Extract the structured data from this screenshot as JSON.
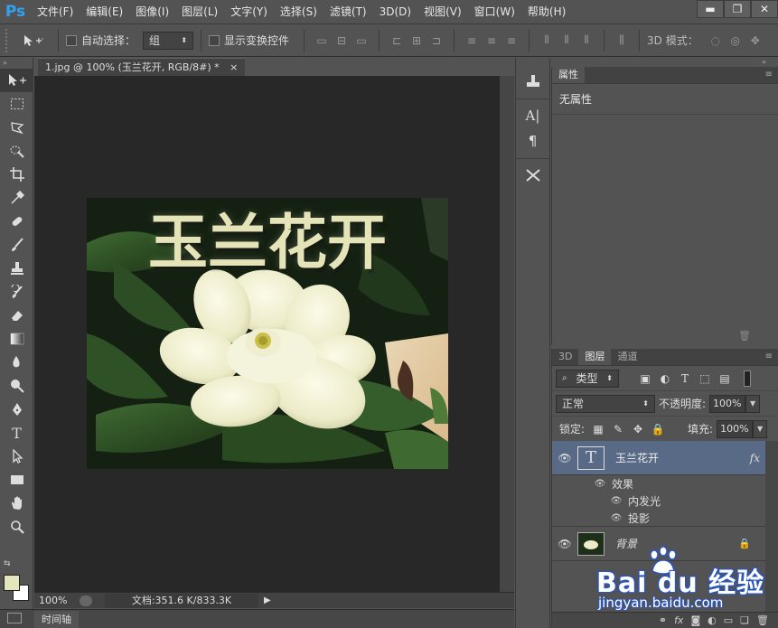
{
  "app": {
    "logo": "Ps"
  },
  "menu": [
    "文件(F)",
    "编辑(E)",
    "图像(I)",
    "图层(L)",
    "文字(Y)",
    "选择(S)",
    "滤镜(T)",
    "3D(D)",
    "视图(V)",
    "窗口(W)",
    "帮助(H)"
  ],
  "window_controls": {
    "minimize": "▬",
    "maximize": "❐",
    "close": "✕"
  },
  "options_bar": {
    "auto_select_label": "自动选择：",
    "auto_select_value": "组",
    "show_transform_label": "显示变换控件",
    "mode_3d_label": "3D 模式："
  },
  "document": {
    "tab_title": "1.jpg @ 100% (玉兰花开, RGB/8#) *",
    "tab_close": "×",
    "image_text": "玉兰花开",
    "zoom": "100%",
    "doc_size": "文档:351.6 K/833.3K"
  },
  "timeline_tab": "时间轴",
  "properties_panel": {
    "tab": "属性",
    "title": "无属性"
  },
  "layers_panel": {
    "tabs": [
      "3D",
      "图层",
      "通道"
    ],
    "filter_label": "类型",
    "blend_mode": "正常",
    "opacity_label": "不透明度:",
    "opacity_value": "100%",
    "lock_label": "锁定:",
    "fill_label": "填充:",
    "fill_value": "100%",
    "layers": [
      {
        "name": "玉兰花开",
        "thumb": "T",
        "fx": "fx",
        "effects_label": "效果",
        "effects": [
          "内发光",
          "投影"
        ]
      },
      {
        "name": "背景"
      }
    ]
  },
  "watermark": {
    "brand": "Bai du 经验",
    "url": "jingyan.baidu.com"
  },
  "colors": {
    "foreground": "#e5e6bb",
    "background": "#ffffff",
    "ps_blue": "#2fa3f2",
    "selected_layer": "#586a85"
  }
}
